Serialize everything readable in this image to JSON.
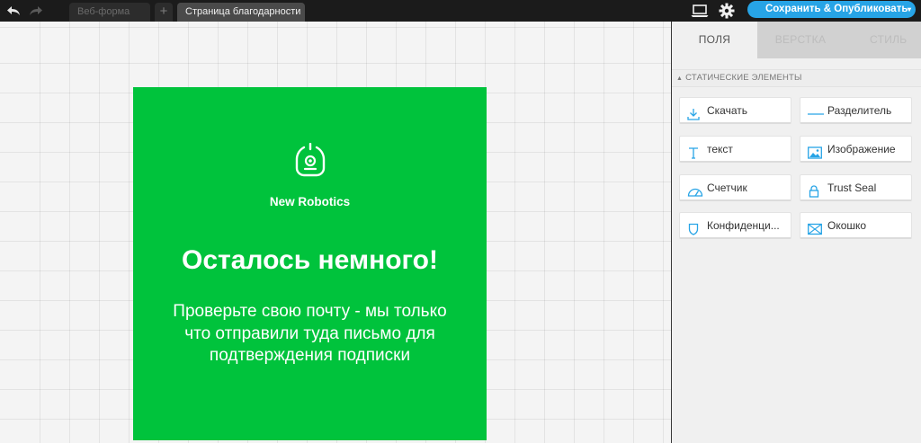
{
  "toolbar": {
    "tabs": [
      "Веб-форма",
      "Страница благодарности"
    ],
    "add_tab": "+",
    "publish_label": "Сохранить & Опубликовать",
    "publish_caret": "▾"
  },
  "card": {
    "brand": "New Robotics",
    "headline": "Осталось немного!",
    "body": "Проверьте свою почту - мы только что отправили туда письмо для подтверждения подписки",
    "background_color": "#00c33c"
  },
  "panel": {
    "tabs": [
      "ПОЛЯ",
      "ВЕРСТКА",
      "СТИЛЬ"
    ],
    "active_tab": "ПОЛЯ",
    "section_title": "СТАТИЧЕСКИЕ ЭЛЕМЕНТЫ",
    "elements": [
      {
        "label": "Скачать",
        "icon": "download-icon"
      },
      {
        "label": "Разделитель",
        "icon": "divider-icon"
      },
      {
        "label": "текст",
        "icon": "text-icon"
      },
      {
        "label": "Изображение",
        "icon": "image-icon"
      },
      {
        "label": "Счетчик",
        "icon": "gauge-icon"
      },
      {
        "label": "Trust Seal",
        "icon": "lock-icon"
      },
      {
        "label": "Конфиденци...",
        "icon": "shield-icon"
      },
      {
        "label": "Окошко",
        "icon": "window-icon"
      }
    ]
  },
  "colors": {
    "accent": "#27a4e6",
    "topbar": "#1b1b1b",
    "card_green": "#00c33c"
  }
}
